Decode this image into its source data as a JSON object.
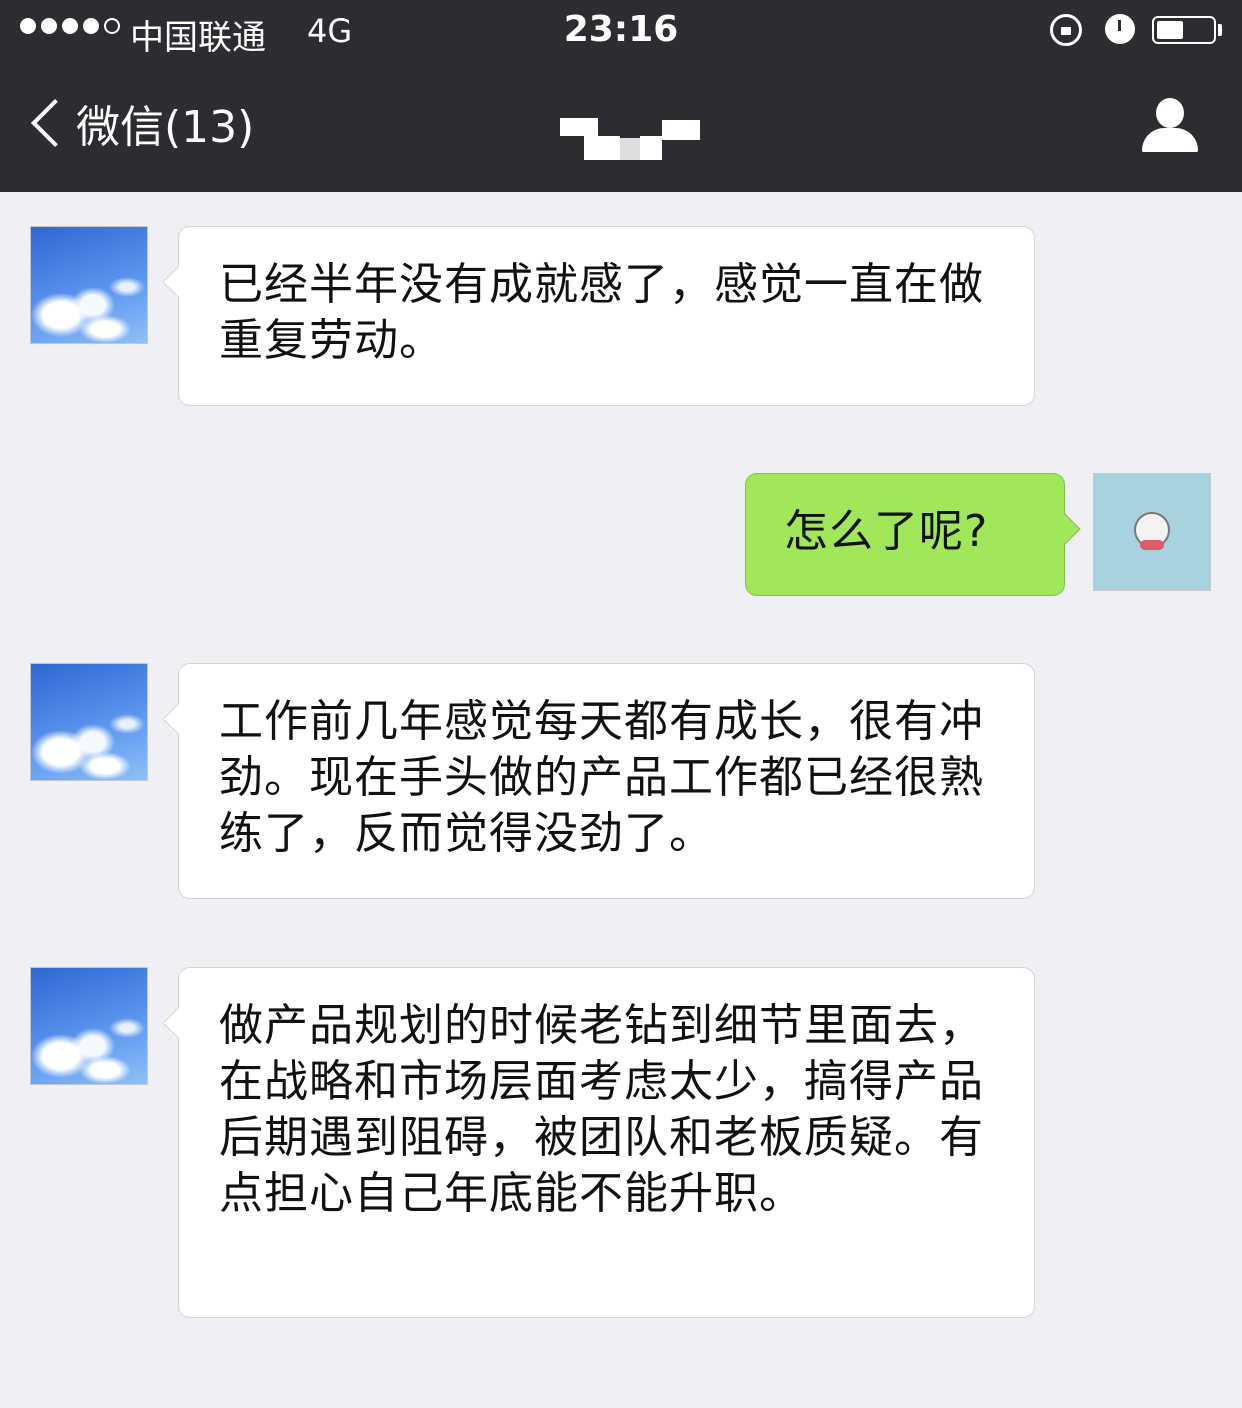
{
  "status_bar": {
    "carrier": "中国联通",
    "network": "4G",
    "time": "23:16"
  },
  "nav": {
    "back_label": "微信(13)"
  },
  "messages": [
    {
      "side": "in",
      "text": "已经半年没有成就感了，感觉一直在做重复劳动。"
    },
    {
      "side": "out",
      "text": "怎么了呢?"
    },
    {
      "side": "in",
      "text": "工作前几年感觉每天都有成长，很有冲劲。现在手头做的产品工作都已经很熟练了，反而觉得没劲了。"
    },
    {
      "side": "in",
      "text": "做产品规划的时候老钻到细节里面去，在战略和市场层面考虑太少，搞得产品后期遇到阻碍，被团队和老板质疑。有点担心自己年底能不能升职。"
    }
  ],
  "colors": {
    "nav_background": "#2d2d31",
    "chat_background": "#efeff4",
    "outgoing_bubble": "#a0e75a",
    "incoming_bubble": "#ffffff"
  }
}
